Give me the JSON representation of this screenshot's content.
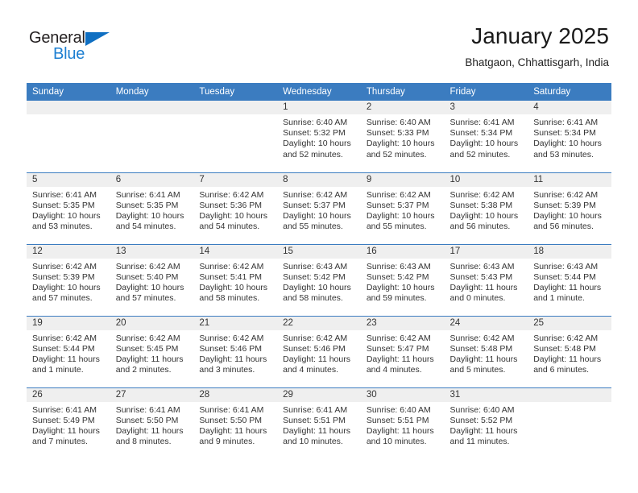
{
  "brand": {
    "name_part1": "General",
    "name_part2": "Blue",
    "triangle_icon": "triangle-logo-icon",
    "accent_color": "#1d7fd1"
  },
  "header": {
    "title": "January 2025",
    "location": "Bhatgaon, Chhattisgarh, India"
  },
  "theme": {
    "header_blue": "#3b7cc0",
    "daynum_band": "#efefef",
    "text": "#333333"
  },
  "calendar": {
    "weekday_headers": [
      "Sunday",
      "Monday",
      "Tuesday",
      "Wednesday",
      "Thursday",
      "Friday",
      "Saturday"
    ],
    "weeks": [
      [
        {
          "day": "",
          "lines": []
        },
        {
          "day": "",
          "lines": []
        },
        {
          "day": "",
          "lines": []
        },
        {
          "day": "1",
          "lines": [
            "Sunrise: 6:40 AM",
            "Sunset: 5:32 PM",
            "Daylight: 10 hours",
            "and 52 minutes."
          ]
        },
        {
          "day": "2",
          "lines": [
            "Sunrise: 6:40 AM",
            "Sunset: 5:33 PM",
            "Daylight: 10 hours",
            "and 52 minutes."
          ]
        },
        {
          "day": "3",
          "lines": [
            "Sunrise: 6:41 AM",
            "Sunset: 5:34 PM",
            "Daylight: 10 hours",
            "and 52 minutes."
          ]
        },
        {
          "day": "4",
          "lines": [
            "Sunrise: 6:41 AM",
            "Sunset: 5:34 PM",
            "Daylight: 10 hours",
            "and 53 minutes."
          ]
        }
      ],
      [
        {
          "day": "5",
          "lines": [
            "Sunrise: 6:41 AM",
            "Sunset: 5:35 PM",
            "Daylight: 10 hours",
            "and 53 minutes."
          ]
        },
        {
          "day": "6",
          "lines": [
            "Sunrise: 6:41 AM",
            "Sunset: 5:35 PM",
            "Daylight: 10 hours",
            "and 54 minutes."
          ]
        },
        {
          "day": "7",
          "lines": [
            "Sunrise: 6:42 AM",
            "Sunset: 5:36 PM",
            "Daylight: 10 hours",
            "and 54 minutes."
          ]
        },
        {
          "day": "8",
          "lines": [
            "Sunrise: 6:42 AM",
            "Sunset: 5:37 PM",
            "Daylight: 10 hours",
            "and 55 minutes."
          ]
        },
        {
          "day": "9",
          "lines": [
            "Sunrise: 6:42 AM",
            "Sunset: 5:37 PM",
            "Daylight: 10 hours",
            "and 55 minutes."
          ]
        },
        {
          "day": "10",
          "lines": [
            "Sunrise: 6:42 AM",
            "Sunset: 5:38 PM",
            "Daylight: 10 hours",
            "and 56 minutes."
          ]
        },
        {
          "day": "11",
          "lines": [
            "Sunrise: 6:42 AM",
            "Sunset: 5:39 PM",
            "Daylight: 10 hours",
            "and 56 minutes."
          ]
        }
      ],
      [
        {
          "day": "12",
          "lines": [
            "Sunrise: 6:42 AM",
            "Sunset: 5:39 PM",
            "Daylight: 10 hours",
            "and 57 minutes."
          ]
        },
        {
          "day": "13",
          "lines": [
            "Sunrise: 6:42 AM",
            "Sunset: 5:40 PM",
            "Daylight: 10 hours",
            "and 57 minutes."
          ]
        },
        {
          "day": "14",
          "lines": [
            "Sunrise: 6:42 AM",
            "Sunset: 5:41 PM",
            "Daylight: 10 hours",
            "and 58 minutes."
          ]
        },
        {
          "day": "15",
          "lines": [
            "Sunrise: 6:43 AM",
            "Sunset: 5:42 PM",
            "Daylight: 10 hours",
            "and 58 minutes."
          ]
        },
        {
          "day": "16",
          "lines": [
            "Sunrise: 6:43 AM",
            "Sunset: 5:42 PM",
            "Daylight: 10 hours",
            "and 59 minutes."
          ]
        },
        {
          "day": "17",
          "lines": [
            "Sunrise: 6:43 AM",
            "Sunset: 5:43 PM",
            "Daylight: 11 hours",
            "and 0 minutes."
          ]
        },
        {
          "day": "18",
          "lines": [
            "Sunrise: 6:43 AM",
            "Sunset: 5:44 PM",
            "Daylight: 11 hours",
            "and 1 minute."
          ]
        }
      ],
      [
        {
          "day": "19",
          "lines": [
            "Sunrise: 6:42 AM",
            "Sunset: 5:44 PM",
            "Daylight: 11 hours",
            "and 1 minute."
          ]
        },
        {
          "day": "20",
          "lines": [
            "Sunrise: 6:42 AM",
            "Sunset: 5:45 PM",
            "Daylight: 11 hours",
            "and 2 minutes."
          ]
        },
        {
          "day": "21",
          "lines": [
            "Sunrise: 6:42 AM",
            "Sunset: 5:46 PM",
            "Daylight: 11 hours",
            "and 3 minutes."
          ]
        },
        {
          "day": "22",
          "lines": [
            "Sunrise: 6:42 AM",
            "Sunset: 5:46 PM",
            "Daylight: 11 hours",
            "and 4 minutes."
          ]
        },
        {
          "day": "23",
          "lines": [
            "Sunrise: 6:42 AM",
            "Sunset: 5:47 PM",
            "Daylight: 11 hours",
            "and 4 minutes."
          ]
        },
        {
          "day": "24",
          "lines": [
            "Sunrise: 6:42 AM",
            "Sunset: 5:48 PM",
            "Daylight: 11 hours",
            "and 5 minutes."
          ]
        },
        {
          "day": "25",
          "lines": [
            "Sunrise: 6:42 AM",
            "Sunset: 5:48 PM",
            "Daylight: 11 hours",
            "and 6 minutes."
          ]
        }
      ],
      [
        {
          "day": "26",
          "lines": [
            "Sunrise: 6:41 AM",
            "Sunset: 5:49 PM",
            "Daylight: 11 hours",
            "and 7 minutes."
          ]
        },
        {
          "day": "27",
          "lines": [
            "Sunrise: 6:41 AM",
            "Sunset: 5:50 PM",
            "Daylight: 11 hours",
            "and 8 minutes."
          ]
        },
        {
          "day": "28",
          "lines": [
            "Sunrise: 6:41 AM",
            "Sunset: 5:50 PM",
            "Daylight: 11 hours",
            "and 9 minutes."
          ]
        },
        {
          "day": "29",
          "lines": [
            "Sunrise: 6:41 AM",
            "Sunset: 5:51 PM",
            "Daylight: 11 hours",
            "and 10 minutes."
          ]
        },
        {
          "day": "30",
          "lines": [
            "Sunrise: 6:40 AM",
            "Sunset: 5:51 PM",
            "Daylight: 11 hours",
            "and 10 minutes."
          ]
        },
        {
          "day": "31",
          "lines": [
            "Sunrise: 6:40 AM",
            "Sunset: 5:52 PM",
            "Daylight: 11 hours",
            "and 11 minutes."
          ]
        },
        {
          "day": "",
          "lines": []
        }
      ]
    ]
  }
}
